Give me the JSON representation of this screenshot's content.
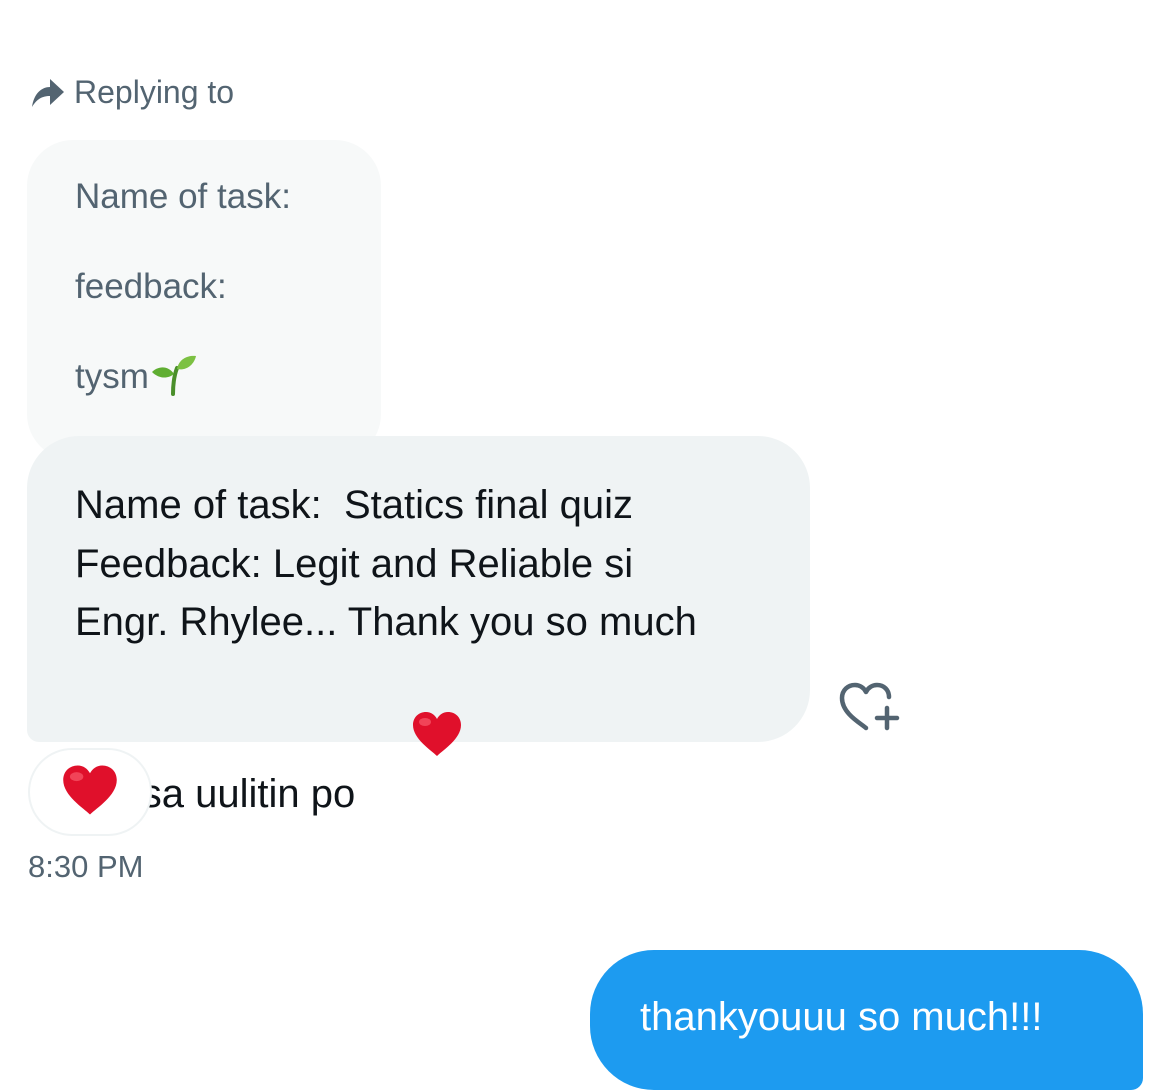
{
  "reply_header": {
    "icon": "reply-arrow-icon",
    "label": "Replying to"
  },
  "quoted_message": {
    "lines": [
      "Name of task:",
      "feedback:",
      "tysm"
    ],
    "emoji_icon": "seedling-icon"
  },
  "received_message": {
    "text": "Name of task:  Statics final quiz\nFeedback: Legit and Reliable si\nEngr. Rhylee... Thank you so much\npo, sa uulitin po",
    "emoji_icon": "red-heart-icon"
  },
  "react_button": {
    "icon": "heart-plus-icon"
  },
  "reaction": {
    "icon": "red-heart-icon"
  },
  "timestamp": "8:30 PM",
  "sent_message": {
    "text": "thankyouuu so much!!!"
  },
  "colors": {
    "sent_bubble": "#1d9bf0",
    "received_bubble": "#eff3f4",
    "quoted_bubble": "#f7f9f9",
    "secondary_text": "#536471",
    "primary_text": "#0f1419",
    "heart": "#e0102b"
  }
}
